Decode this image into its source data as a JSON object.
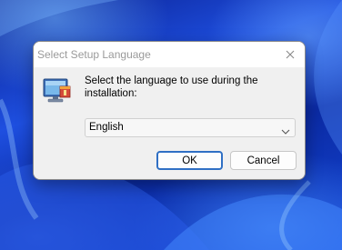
{
  "dialog": {
    "title": "Select Setup Language",
    "prompt": "Select the language to use during the installation:",
    "language_select": {
      "selected": "English"
    },
    "buttons": {
      "ok_label": "OK",
      "cancel_label": "Cancel"
    }
  },
  "icons": {
    "close": "close-icon",
    "setup": "setup-computer-icon",
    "dropdown": "chevron-down-icon"
  },
  "colors": {
    "desktop_background": "#1e4fe0",
    "dialog_background": "#f0f0f0",
    "titlebar_background": "#ffffff",
    "ok_button_border": "#2f6fc4"
  }
}
